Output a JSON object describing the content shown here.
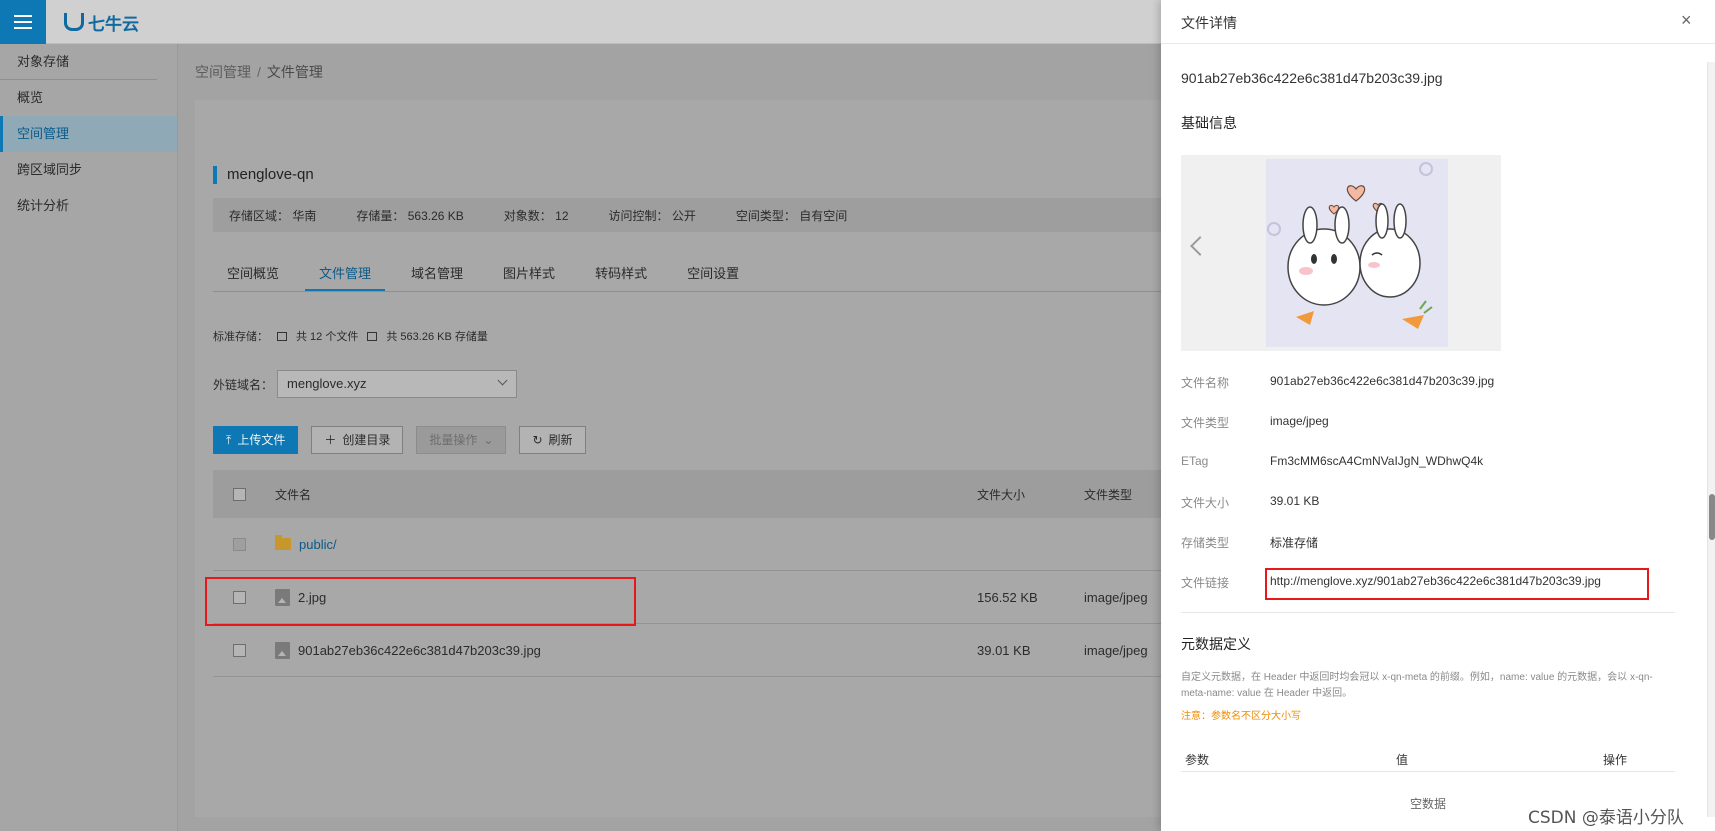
{
  "brand": {
    "logo_text": "七牛云"
  },
  "sidebar": {
    "items": [
      {
        "label": "对象存储"
      },
      {
        "label": "概览"
      },
      {
        "label": "空间管理"
      },
      {
        "label": "跨区域同步"
      },
      {
        "label": "统计分析"
      }
    ]
  },
  "breadcrumb": {
    "parent": "空间管理",
    "separator": "/",
    "current": "文件管理"
  },
  "bucket": {
    "name": "menglove-qn",
    "region_label": "存储区域：",
    "region": "华南",
    "storage_label": "存储量：",
    "storage": "563.26 KB",
    "objects_label": "对象数：",
    "objects": "12",
    "access_label": "访问控制：",
    "access": "公开",
    "type_label": "空间类型：",
    "type": "自有空间"
  },
  "tabs": [
    {
      "label": "空间概览"
    },
    {
      "label": "文件管理"
    },
    {
      "label": "域名管理"
    },
    {
      "label": "图片样式"
    },
    {
      "label": "转码样式"
    },
    {
      "label": "空间设置"
    }
  ],
  "storage_line": {
    "prefix": "标准存储：",
    "files": "共 12 个文件",
    "size": "共 563.26 KB 存储量"
  },
  "domain": {
    "label": "外链域名：",
    "value": "menglove.xyz"
  },
  "buttons": {
    "upload": "上传文件",
    "mkdir": "创建目录",
    "batch": "批量操作",
    "refresh": "刷新"
  },
  "table": {
    "headers": {
      "name": "文件名",
      "size": "文件大小",
      "type": "文件类型"
    },
    "rows": [
      {
        "name": "public/",
        "size": "",
        "type": ""
      },
      {
        "name": "2.jpg",
        "size": "156.52 KB",
        "type": "image/jpeg"
      },
      {
        "name": "901ab27eb36c422e6c381d47b203c39.jpg",
        "size": "39.01 KB",
        "type": "image/jpeg"
      }
    ]
  },
  "drawer": {
    "title": "文件详情",
    "filename": "901ab27eb36c422e6c381d47b203c39.jpg",
    "basic_title": "基础信息",
    "details": [
      {
        "key": "文件名称",
        "value": "901ab27eb36c422e6c381d47b203c39.jpg"
      },
      {
        "key": "文件类型",
        "value": "image/jpeg"
      },
      {
        "key": "ETag",
        "value": "Fm3cMM6scA4CmNVaIJgN_WDhwQ4k"
      },
      {
        "key": "文件大小",
        "value": "39.01 KB"
      },
      {
        "key": "存储类型",
        "value": "标准存储"
      },
      {
        "key": "文件链接",
        "value": "http://menglove.xyz/901ab27eb36c422e6c381d47b203c39.jpg"
      }
    ],
    "meta_title": "元数据定义",
    "meta_desc": "自定义元数据，在 Header 中返回时均会冠以 x-qn-meta 的前缀。例如，name: value 的元数据，会以 x-qn-meta-name: value 在 Header 中返回。",
    "meta_note": "注意：参数名不区分大小写",
    "meta_headers": {
      "param": "参数",
      "value": "值",
      "action": "操作"
    },
    "meta_empty": "空数据"
  },
  "watermark": "CSDN @泰语小分队",
  "colors": {
    "accent": "#0e78b4",
    "highlight": "#e8171c",
    "note": "#f08c00"
  }
}
